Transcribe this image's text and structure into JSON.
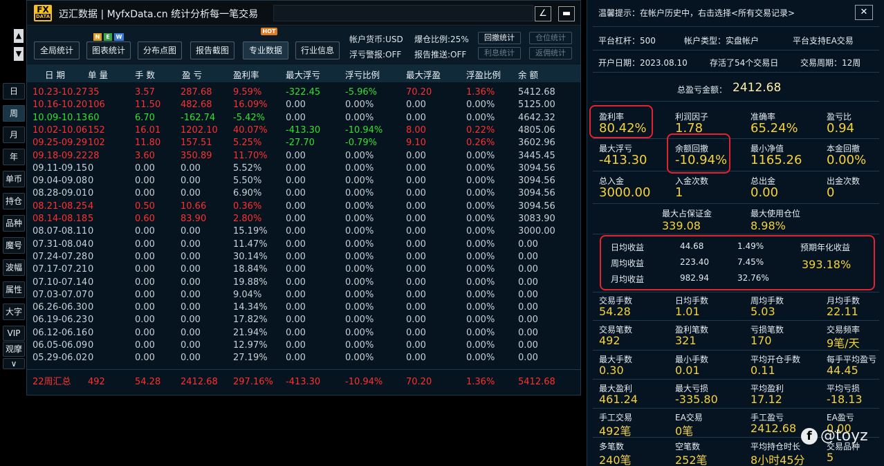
{
  "window": {
    "title": "迈汇数据 | MyfxData.cn  统计分析每一笔交易",
    "logo_top": "FX",
    "logo_bottom": "DATA"
  },
  "toolbar": {
    "buttons": [
      "全局统计",
      "图表统计",
      "分布点图",
      "报告截图",
      "专业数据",
      "行业信息"
    ],
    "badge_new": [
      "N",
      "E",
      "W"
    ],
    "badge_hot": "HOT",
    "account_currency": "帐户货币:USD",
    "margin_ratio": "爆仓比例:25%",
    "float_alert": "浮亏警报:OFF",
    "report_push": "报告推送:OFF",
    "small_buttons": [
      "回撤统计",
      "仓位统计",
      "利息统计",
      "返佣统计"
    ]
  },
  "side_nav": {
    "up": "▲",
    "down": "▼",
    "items": [
      "日",
      "周",
      "月",
      "年",
      "单币",
      "持仓",
      "品种",
      "魔号",
      "波幅",
      "属性",
      "大字",
      "VIP",
      "观摩"
    ],
    "more": "∨"
  },
  "table": {
    "headers": [
      "日 期",
      "单 量",
      "手 数",
      "盈 亏",
      "盈利率",
      "最大浮亏",
      "浮亏比例",
      "最大浮盈",
      "浮盈比例",
      "余 额"
    ],
    "rows": [
      {
        "c": [
          "10.23-10.27",
          "35",
          "3.57",
          "287.68",
          "9.59%",
          "-322.45",
          "-5.96%",
          "70.20",
          "1.36%",
          "5412.68"
        ],
        "color": "red",
        "dd": "green"
      },
      {
        "c": [
          "10.16-10.20",
          "106",
          "11.50",
          "482.68",
          "16.09%",
          "0.00",
          "0.00%",
          "0.00",
          "0.00%",
          "5125.00"
        ],
        "color": "red"
      },
      {
        "c": [
          "10.09-10.13",
          "60",
          "6.70",
          "-162.74",
          "-5.42%",
          "0.00",
          "0.00%",
          "0.00",
          "0.00%",
          "4642.32"
        ],
        "color": "green"
      },
      {
        "c": [
          "10.02-10.06",
          "152",
          "16.01",
          "1202.10",
          "40.07%",
          "-413.30",
          "-10.94%",
          "8.00",
          "0.22%",
          "4805.06"
        ],
        "color": "red",
        "dd": "green"
      },
      {
        "c": [
          "09.25-09.29",
          "102",
          "11.80",
          "157.51",
          "5.25%",
          "-27.70",
          "-0.79%",
          "9.10",
          "0.26%",
          "3602.96"
        ],
        "color": "red",
        "dd": "green"
      },
      {
        "c": [
          "09.18-09.22",
          "28",
          "3.60",
          "350.89",
          "11.70%",
          "0.00",
          "0.00%",
          "0.00",
          "0.00%",
          "3445.45"
        ],
        "color": "red"
      },
      {
        "c": [
          "09.11-09.15",
          "0",
          "0.00",
          "0.00",
          "5.52%",
          "0.00",
          "0.00%",
          "0.00",
          "0.00%",
          "3094.56"
        ],
        "color": "gray"
      },
      {
        "c": [
          "09.04-09.08",
          "0",
          "0.00",
          "0.00",
          "5.50%",
          "0.00",
          "0.00%",
          "0.00",
          "0.00%",
          "3094.56"
        ],
        "color": "gray"
      },
      {
        "c": [
          "08.28-09.01",
          "0",
          "0.00",
          "0.00",
          "6.90%",
          "0.00",
          "0.00%",
          "0.00",
          "0.00%",
          "3094.56"
        ],
        "color": "gray"
      },
      {
        "c": [
          "08.21-08.25",
          "4",
          "0.50",
          "10.66",
          "0.36%",
          "0.00",
          "0.00%",
          "0.00",
          "0.00%",
          "3094.56"
        ],
        "color": "red"
      },
      {
        "c": [
          "08.14-08.18",
          "5",
          "0.60",
          "83.90",
          "2.80%",
          "0.00",
          "0.00%",
          "0.00",
          "0.00%",
          "3083.90"
        ],
        "color": "red"
      },
      {
        "c": [
          "08.07-08.11",
          "0",
          "0.00",
          "0.00",
          "15.19%",
          "0.00",
          "0.00%",
          "0.00",
          "0.00%",
          "3000.00"
        ],
        "color": "gray"
      },
      {
        "c": [
          "07.31-08.04",
          "0",
          "0.00",
          "0.00",
          "11.47%",
          "0.00",
          "0.00%",
          "0.00",
          "0.00%",
          "0.00"
        ],
        "color": "gray"
      },
      {
        "c": [
          "07.24-07.28",
          "0",
          "0.00",
          "0.00",
          "30.14%",
          "0.00",
          "0.00%",
          "0.00",
          "0.00%",
          "0.00"
        ],
        "color": "gray"
      },
      {
        "c": [
          "07.17-07.21",
          "0",
          "0.00",
          "0.00",
          "18.84%",
          "0.00",
          "0.00%",
          "0.00",
          "0.00%",
          "0.00"
        ],
        "color": "gray"
      },
      {
        "c": [
          "07.10-07.14",
          "0",
          "0.00",
          "0.00",
          "19.88%",
          "0.00",
          "0.00%",
          "0.00",
          "0.00%",
          "0.00"
        ],
        "color": "gray"
      },
      {
        "c": [
          "07.03-07.07",
          "0",
          "0.00",
          "0.00",
          "9.04%",
          "0.00",
          "0.00%",
          "0.00",
          "0.00%",
          "0.00"
        ],
        "color": "gray"
      },
      {
        "c": [
          "06.26-06.30",
          "0",
          "0.00",
          "0.00",
          "14.34%",
          "0.00",
          "0.00%",
          "0.00",
          "0.00%",
          "0.00"
        ],
        "color": "gray"
      },
      {
        "c": [
          "06.19-06.23",
          "0",
          "0.00",
          "0.00",
          "17.82%",
          "0.00",
          "0.00%",
          "0.00",
          "0.00%",
          "0.00"
        ],
        "color": "gray"
      },
      {
        "c": [
          "06.12-06.16",
          "0",
          "0.00",
          "0.00",
          "21.94%",
          "0.00",
          "0.00%",
          "0.00",
          "0.00%",
          "0.00"
        ],
        "color": "gray"
      },
      {
        "c": [
          "06.05-06.09",
          "0",
          "0.00",
          "0.00",
          "12.97%",
          "0.00",
          "0.00%",
          "0.00",
          "0.00%",
          "0.00"
        ],
        "color": "gray"
      },
      {
        "c": [
          "05.29-06.02",
          "0",
          "0.00",
          "0.00",
          "27.19%",
          "0.00",
          "0.00%",
          "0.00",
          "0.00%",
          "0.00"
        ],
        "color": "gray"
      }
    ],
    "summary": [
      "22周汇总",
      "492",
      "54.28",
      "2412.68",
      "297.16%",
      "-413.30",
      "-10.94%",
      "70.20",
      "1.36%",
      "5412.68"
    ]
  },
  "stats": {
    "tip": "温馨提示：在帐户历史中，右击选择<所有交易记录>",
    "close": "✕",
    "leverage": "平台杠杆：500",
    "account_type": "帐户类型：实盘帐户",
    "ea_support": "平台支持EA交易",
    "open_date": "开户日期：2023.08.10",
    "trade_days": "存活了54个交易日",
    "trade_period": "交易周期：12周",
    "total_label": "总盈亏金额：",
    "total_value": "2412.68",
    "grid1": [
      {
        "l": "盈利率",
        "v": "80.42%"
      },
      {
        "l": "利润因子",
        "v": "1.78"
      },
      {
        "l": "准确率",
        "v": "65.24%"
      },
      {
        "l": "盈亏比",
        "v": "0.94"
      },
      {
        "l": "最大浮亏",
        "v": "-413.30"
      },
      {
        "l": "余额回撤",
        "v": "-10.94%"
      },
      {
        "l": "最小净值",
        "v": "1165.26"
      },
      {
        "l": "本金回撤",
        "v": "0.00%"
      },
      {
        "l": "总入金",
        "v": "3000.00"
      },
      {
        "l": "入金次数",
        "v": "1"
      },
      {
        "l": "总出金",
        "v": "0.00"
      },
      {
        "l": "出金次数",
        "v": "0"
      }
    ],
    "max_margin_label": "最大占保证金",
    "max_margin_value": "339.08",
    "max_pos_label": "最大使用仓位",
    "max_pos_value": "8.98%",
    "returns": [
      {
        "l": "日均收益",
        "v": "44.68",
        "p": "1.49%"
      },
      {
        "l": "周均收益",
        "v": "223.40",
        "p": "7.45%"
      },
      {
        "l": "月均收益",
        "v": "982.94",
        "p": "32.76%"
      }
    ],
    "annual_label": "预期年化收益",
    "annual_value": "393.18%",
    "grid2": [
      {
        "l": "交易手数",
        "v": "54.28"
      },
      {
        "l": "日均手数",
        "v": "1.01"
      },
      {
        "l": "周均手数",
        "v": "5.03"
      },
      {
        "l": "月均手数",
        "v": "22.11"
      },
      {
        "l": "交易笔数",
        "v": "492"
      },
      {
        "l": "盈利笔数",
        "v": "321"
      },
      {
        "l": "亏损笔数",
        "v": "170"
      },
      {
        "l": "交易频率",
        "v": "9笔/天"
      },
      {
        "l": "最大手数",
        "v": "0.30"
      },
      {
        "l": "最小手数",
        "v": "0.01"
      },
      {
        "l": "平均开仓手数",
        "v": "0.11"
      },
      {
        "l": "每手平均盈亏",
        "v": "44.45"
      },
      {
        "l": "最大盈利",
        "v": "461.24"
      },
      {
        "l": "最大亏损",
        "v": "-335.80"
      },
      {
        "l": "平均盈利",
        "v": "17.12"
      },
      {
        "l": "平均亏损",
        "v": "-18.13"
      },
      {
        "l": "手工交易",
        "v": "492笔"
      },
      {
        "l": "EA交易",
        "v": "0笔"
      },
      {
        "l": "手工盈亏",
        "v": "2412.68"
      },
      {
        "l": "EA盈亏",
        "v": "0.00"
      },
      {
        "l": "多笔数",
        "v": "240笔"
      },
      {
        "l": "空笔数",
        "v": "252笔"
      },
      {
        "l": "平均持仓时长",
        "v": "8小时45分"
      },
      {
        "l": "交易品种",
        "v": "5"
      }
    ]
  },
  "watermark": {
    "icon": "f",
    "text": "@toyz"
  },
  "colors": {
    "red": "#ff3030",
    "green": "#33e033",
    "gray": "#c9d1d8",
    "yellow": "#f5d23c"
  }
}
